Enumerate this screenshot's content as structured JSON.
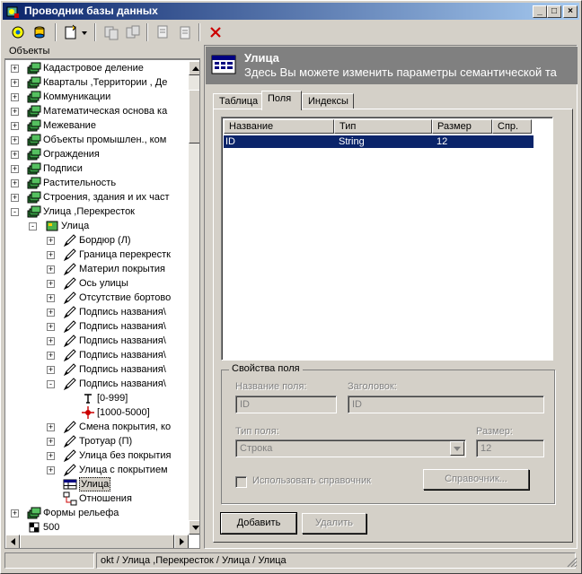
{
  "window": {
    "title": "Проводник базы данных"
  },
  "left": {
    "header": "Объекты",
    "tree": [
      {
        "label": "Кадастровое деление",
        "level": 1,
        "expander": "+",
        "icon": "layers"
      },
      {
        "label": "Кварталы ,Территории , Де",
        "level": 1,
        "expander": "+",
        "icon": "layers"
      },
      {
        "label": "Коммуникации",
        "level": 1,
        "expander": "+",
        "icon": "layers"
      },
      {
        "label": "Математическая основа ка",
        "level": 1,
        "expander": "+",
        "icon": "layers"
      },
      {
        "label": "Межевание",
        "level": 1,
        "expander": "+",
        "icon": "layers"
      },
      {
        "label": "Объекты промышлен., ком",
        "level": 1,
        "expander": "+",
        "icon": "layers"
      },
      {
        "label": "Ограждения",
        "level": 1,
        "expander": "+",
        "icon": "layers"
      },
      {
        "label": "Подписи",
        "level": 1,
        "expander": "+",
        "icon": "layers"
      },
      {
        "label": "Растительность",
        "level": 1,
        "expander": "+",
        "icon": "layers"
      },
      {
        "label": "Строения, здания и их част",
        "level": 1,
        "expander": "+",
        "icon": "layers"
      },
      {
        "label": "Улица ,Перекресток",
        "level": 1,
        "expander": "-",
        "icon": "layers"
      },
      {
        "label": "Улица",
        "level": 2,
        "expander": "-",
        "icon": "layer-green"
      },
      {
        "label": "Бордюр (Л)",
        "level": 3,
        "expander": "+",
        "icon": "pencil"
      },
      {
        "label": "Граница перекрестк",
        "level": 3,
        "expander": "+",
        "icon": "pencil"
      },
      {
        "label": "Материл покрытия",
        "level": 3,
        "expander": "+",
        "icon": "pencil"
      },
      {
        "label": "Ось улицы",
        "level": 3,
        "expander": "+",
        "icon": "pencil"
      },
      {
        "label": "Отсутствие бортово",
        "level": 3,
        "expander": "+",
        "icon": "pencil"
      },
      {
        "label": "Подпись названия\\",
        "level": 3,
        "expander": "+",
        "icon": "pencil"
      },
      {
        "label": "Подпись названия\\",
        "level": 3,
        "expander": "+",
        "icon": "pencil"
      },
      {
        "label": "Подпись названия\\",
        "level": 3,
        "expander": "+",
        "icon": "pencil"
      },
      {
        "label": "Подпись названия\\",
        "level": 3,
        "expander": "+",
        "icon": "pencil"
      },
      {
        "label": "Подпись названия\\",
        "level": 3,
        "expander": "+",
        "icon": "pencil"
      },
      {
        "label": "Подпись названия\\",
        "level": 3,
        "expander": "-",
        "icon": "pencil"
      },
      {
        "label": "[0-999]",
        "level": 4,
        "expander": "",
        "icon": "text-scale"
      },
      {
        "label": "[1000-5000]",
        "level": 4,
        "expander": "",
        "icon": "red-mark"
      },
      {
        "label": "Смена покрытия, ко",
        "level": 3,
        "expander": "+",
        "icon": "pencil"
      },
      {
        "label": "Тротуар (П)",
        "level": 3,
        "expander": "+",
        "icon": "pencil"
      },
      {
        "label": "Улица без покрытия",
        "level": 3,
        "expander": "+",
        "icon": "pencil"
      },
      {
        "label": "Улица с покрытием",
        "level": 3,
        "expander": "+",
        "icon": "pencil"
      },
      {
        "label": "Улица",
        "level": 3,
        "expander": "",
        "icon": "table",
        "selected": true
      },
      {
        "label": "Отношения",
        "level": 3,
        "expander": "",
        "icon": "relations"
      },
      {
        "label": "Формы рельефа",
        "level": 1,
        "expander": "+",
        "icon": "layers"
      },
      {
        "label": "500",
        "level": 1,
        "expander": "",
        "icon": "checker"
      }
    ]
  },
  "right": {
    "banner": {
      "title": "Улица",
      "subtitle": "Здесь Вы можете изменить параметры семантической та"
    },
    "tabs": [
      "Таблица",
      "Поля",
      "Индексы"
    ],
    "active_tab": "Поля",
    "fields_table": {
      "columns": [
        "Название",
        "Тип",
        "Размер",
        "Спр."
      ],
      "rows": [
        {
          "name": "ID",
          "type": "String",
          "size": "12",
          "ref": ""
        }
      ]
    },
    "props": {
      "title": "Свойства поля",
      "field_name_label": "Название поля:",
      "field_name_value": "ID",
      "header_label": "Заголовок:",
      "header_value": "ID",
      "type_label": "Тип поля:",
      "type_value": "Строка",
      "size_label": "Размер:",
      "size_value": "12",
      "use_ref_label": "Использовать справочник",
      "ref_button": "Справочник..."
    },
    "buttons": {
      "add": "Добавить",
      "delete": "Удалить"
    }
  },
  "status": {
    "path": "okt / Улица ,Перекресток / Улица / Улица"
  },
  "colors": {
    "title_start": "#0a246a",
    "title_end": "#a6caf0",
    "selection": "#0a246a",
    "banner": "#808080",
    "face": "#d4d0c8"
  }
}
